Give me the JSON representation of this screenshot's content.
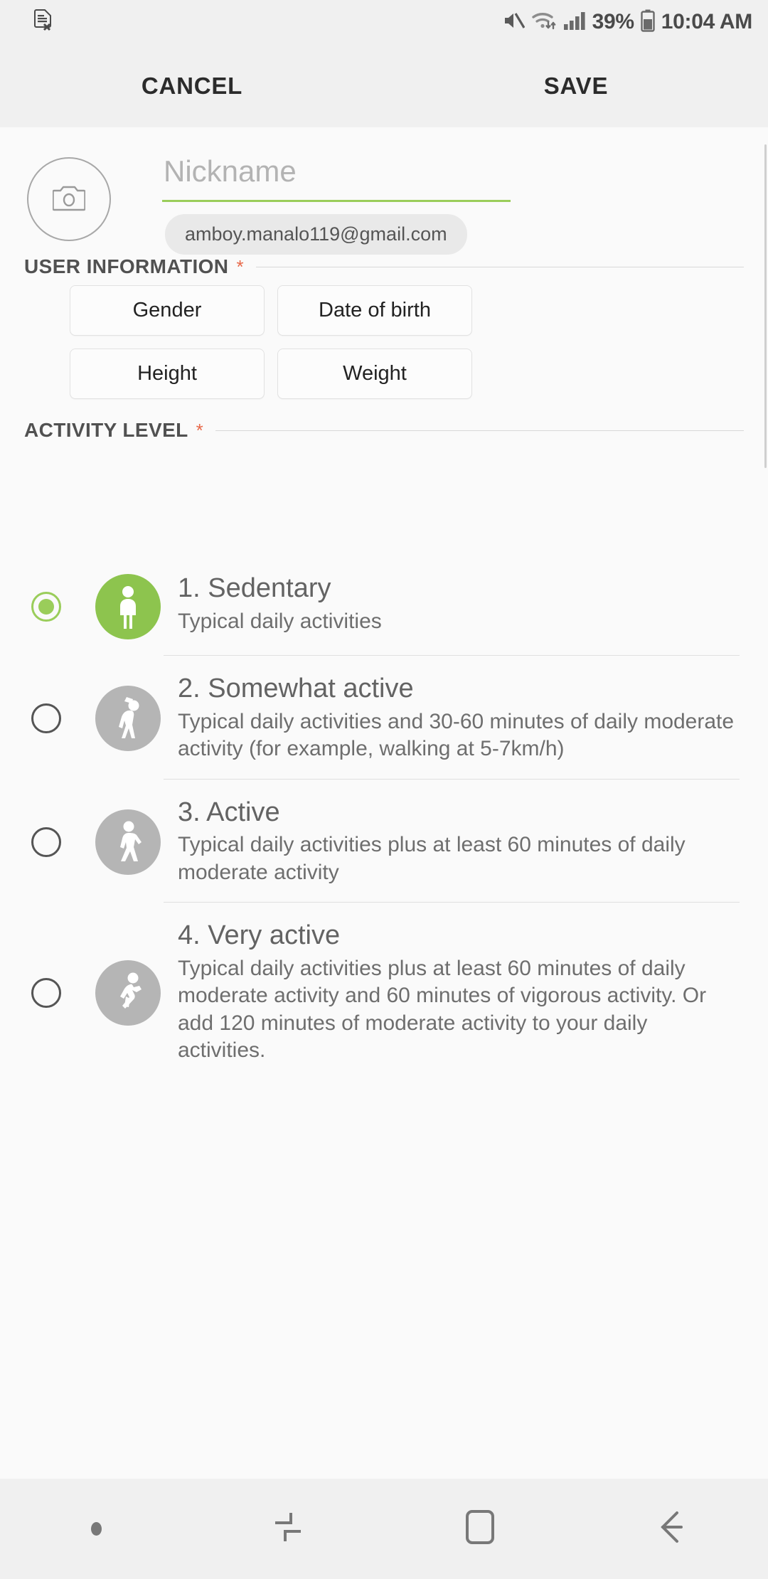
{
  "status_bar": {
    "time": "10:04 AM",
    "battery_percent": "39%",
    "icons": [
      "sim-card-error-icon",
      "mute-icon",
      "wifi-icon",
      "signal-bars-icon",
      "battery-icon"
    ]
  },
  "action_bar": {
    "cancel_label": "CANCEL",
    "save_label": "SAVE"
  },
  "profile": {
    "avatar_icon": "camera-icon",
    "nickname_value": "",
    "nickname_placeholder": "Nickname",
    "email": "amboy.manalo119@gmail.com",
    "underline_color": "#9acd5a"
  },
  "user_information": {
    "title": "USER INFORMATION",
    "required_marker": "*",
    "buttons": [
      {
        "label": "Gender"
      },
      {
        "label": "Date of birth"
      },
      {
        "label": "Height"
      },
      {
        "label": "Weight"
      }
    ]
  },
  "activity_level": {
    "title": "ACTIVITY LEVEL",
    "required_marker": "*",
    "selected_index": 0,
    "selected_color": "#8dc44e",
    "unselected_color": "#b5b5b5",
    "options": [
      {
        "title": "1. Sedentary",
        "description": "Typical daily activities",
        "icon": "standing-person-icon"
      },
      {
        "title": "2. Somewhat active",
        "description": "Typical daily activities and 30-60 minutes of daily moderate activity (for example, walking at 5-7km/h)",
        "icon": "stretching-person-icon"
      },
      {
        "title": "3. Active",
        "description": "Typical daily activities plus at least 60 minutes of daily moderate activity",
        "icon": "walking-person-icon"
      },
      {
        "title": "4. Very active",
        "description": "Typical daily activities plus at least 60 minutes of daily moderate activity and 60 minutes of vigorous activity. Or add 120 minutes of moderate activity to your daily activities.",
        "icon": "running-person-icon"
      }
    ]
  },
  "nav_bar": {
    "items": [
      "status-dot",
      "recents-icon",
      "home-icon",
      "back-icon"
    ]
  },
  "colors": {
    "accent_green": "#9acd5a",
    "required_star": "#e8694a",
    "bar_background": "#f0f0f0",
    "page_background": "#fafafa"
  }
}
